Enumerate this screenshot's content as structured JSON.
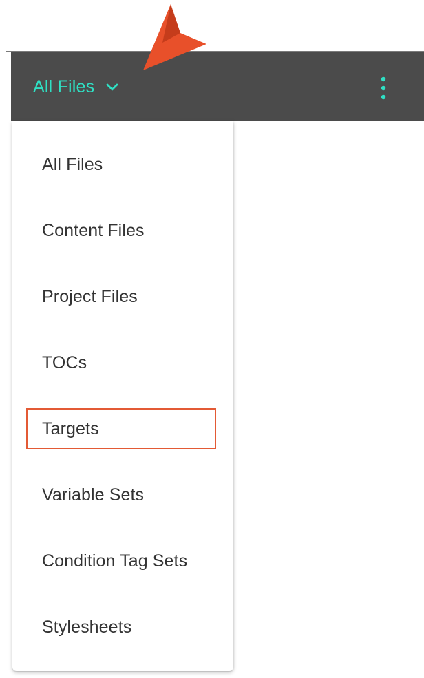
{
  "header": {
    "filter_label": "All Files",
    "accent_color": "#2fe0c4",
    "bar_color": "#4b4b4b"
  },
  "dropdown": {
    "items": [
      {
        "label": "All Files"
      },
      {
        "label": "Content Files"
      },
      {
        "label": "Project Files"
      },
      {
        "label": "TOCs"
      },
      {
        "label": "Targets",
        "highlighted": true
      },
      {
        "label": "Variable Sets"
      },
      {
        "label": "Condition Tag Sets"
      },
      {
        "label": "Stylesheets"
      }
    ]
  },
  "annotations": {
    "highlight_color": "#e35a35",
    "arrow_color": "#e8502a"
  },
  "icons": {
    "chevron": "chevron-down-icon",
    "kebab": "more-vertical-icon",
    "arrow": "callout-arrow-icon"
  }
}
